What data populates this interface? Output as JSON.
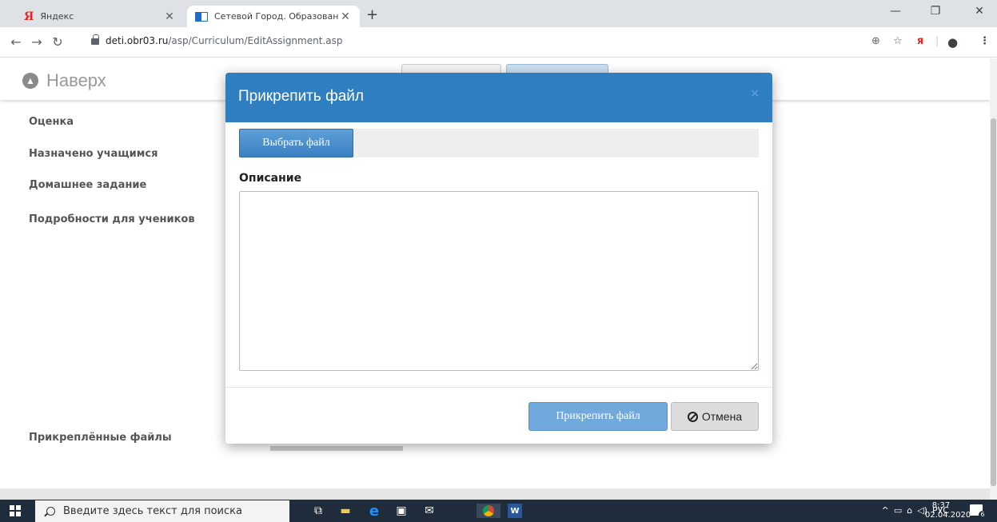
{
  "browser": {
    "tabs": [
      {
        "title": "Яндекс",
        "favicon": "yandex-icon",
        "active": false
      },
      {
        "title": "Сетевой Город. Образование. Р",
        "favicon": "netcity-icon",
        "active": true
      }
    ],
    "address": {
      "host": "deti.obr03.ru",
      "path": "/asp/Curriculum/EditAssignment.asp"
    }
  },
  "page": {
    "back_to_top": "Наверх",
    "labels": {
      "grade": "Оценка",
      "assigned": "Назначено учащимся",
      "homework": "Домашнее задание",
      "details": "Подробности для учеников",
      "attached_files": "Прикреплённые файлы"
    }
  },
  "modal": {
    "title": "Прикрепить файл",
    "close": "×",
    "choose_file": "Выбрать файл",
    "description_label": "Описание",
    "description_value": "",
    "attach_button": "Прикрепить файл",
    "cancel_button": "Отмена",
    "header_color": "#2f7fc0"
  },
  "taskbar": {
    "search_placeholder": "Введите здесь текст для поиска",
    "tray_lang": "РУС",
    "time": "8:37",
    "date": "02.04.2020",
    "notifications": "6"
  }
}
